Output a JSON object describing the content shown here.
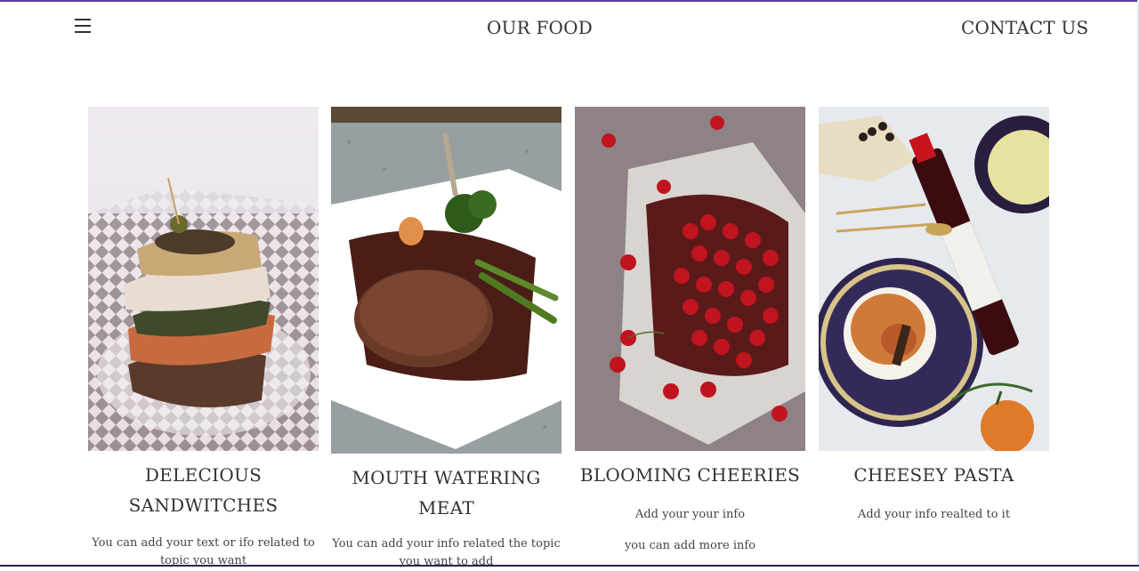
{
  "nav": {
    "menu_icon": "hamburger-menu-icon",
    "our_food": "OUR FOOD",
    "contact_us": "CONTACT US"
  },
  "cards": [
    {
      "title_line1": "DELECIOUS",
      "title_line2": "SANDWITCHES",
      "text1": "You can add your text or ifo related to",
      "text2": "topic you want"
    },
    {
      "title_line1": "MOUTH WATERING",
      "title_line2": "MEAT",
      "text1": "You can add your info related the topic",
      "text2": "you want to add"
    },
    {
      "title_line1": "BLOOMING CHEERIES",
      "text1": "Add your your info",
      "text2": "you can add more info"
    },
    {
      "title_line1": "CHEESEY PASTA",
      "text1": "Add your info realted to it"
    }
  ],
  "colors": {
    "accent": "#5b3e96",
    "text": "#333333"
  }
}
